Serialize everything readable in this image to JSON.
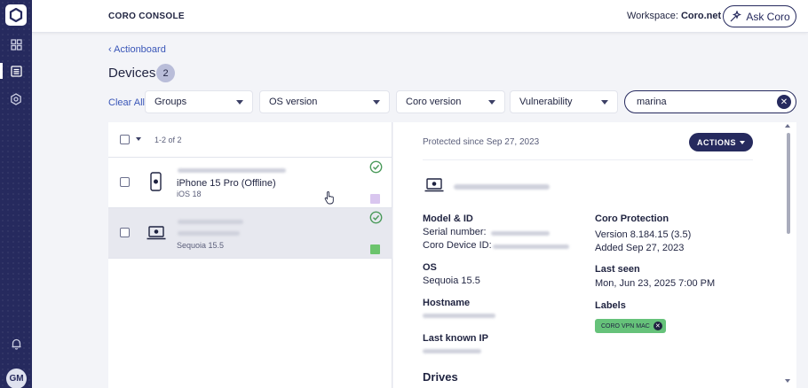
{
  "app": {
    "console_title": "CORO CONSOLE"
  },
  "topbar": {
    "workspace_label": "Workspace:",
    "workspace_value": "Coro.net",
    "ask_coro": "Ask Coro"
  },
  "sidebar": {
    "avatar_initials": "GM",
    "icons": [
      "logo-icon",
      "dashboard-icon",
      "actionboard-icon",
      "settings-icon",
      "bell-icon"
    ]
  },
  "breadcrumb": "‹ Actionboard",
  "page": {
    "title": "Devices",
    "count": "2"
  },
  "filters": {
    "clear_all": "Clear All",
    "groups": "Groups",
    "os_version": "OS version",
    "coro_version": "Coro version",
    "vulnerability": "Vulnerability",
    "search_value": "marina"
  },
  "list": {
    "range": "1-2 of 2",
    "rows": [
      {
        "name": "iPhone 15 Pro (Offline)",
        "os": "iOS 18",
        "status_color": "#d9c6ef",
        "icon": "phone-icon"
      },
      {
        "name": "",
        "os": "Sequoia 15.5",
        "status_color": "#6cc46d",
        "icon": "laptop-icon"
      }
    ]
  },
  "detail": {
    "protected_since": "Protected since Sep 27, 2023",
    "actions": "ACTIONS",
    "model_id_label": "Model & ID",
    "serial_label": "Serial number:",
    "coro_device_id_label": "Coro Device ID:",
    "os_label": "OS",
    "os_value": "Sequoia 15.5",
    "hostname_label": "Hostname",
    "last_ip_label": "Last known IP",
    "coro_protection_label": "Coro Protection",
    "coro_version": "Version 8.184.15 (3.5)",
    "added": "Added Sep 27, 2023",
    "last_seen_label": "Last seen",
    "last_seen_value": "Mon, Jun 23, 2025 7:00 PM",
    "labels_label": "Labels",
    "label_chip": "CORO VPN MAC",
    "drives_label": "Drives"
  },
  "colors": {
    "sidebar": "#262a5e",
    "accent": "#262a5e",
    "link": "#3a56b8",
    "check": "#4a9a5a"
  }
}
